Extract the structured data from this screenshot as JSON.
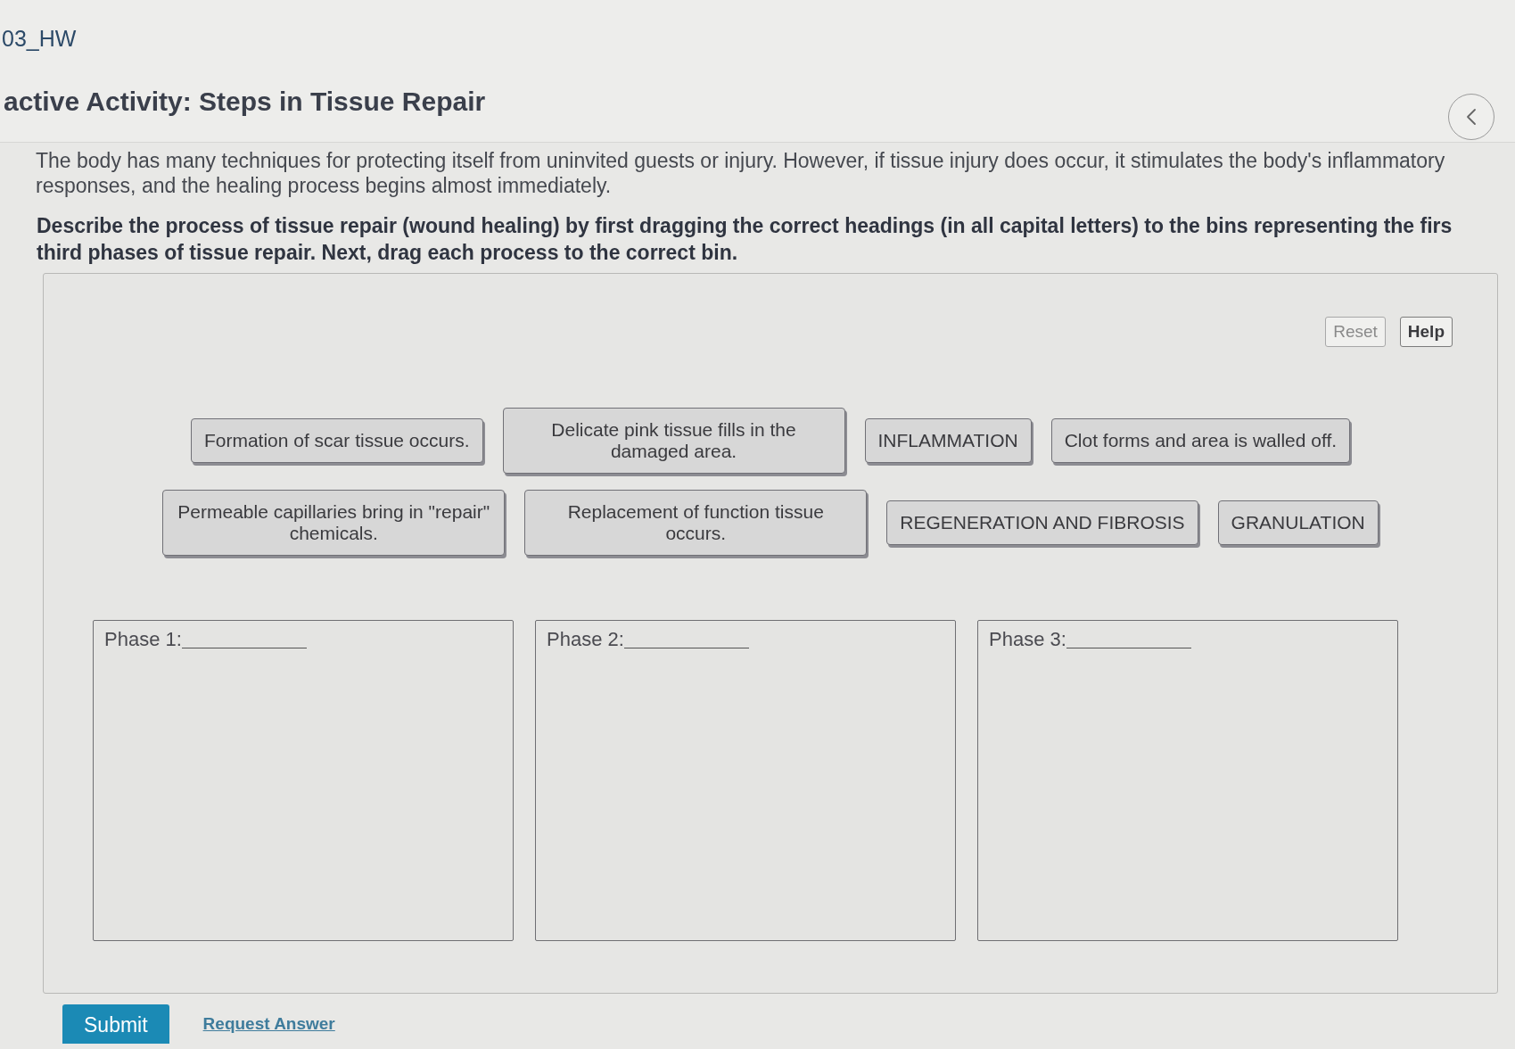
{
  "assignment": {
    "title": "03_HW"
  },
  "activity": {
    "title": "active Activity: Steps in Tissue Repair"
  },
  "intro": {
    "lines": [
      "The body has many techniques for protecting itself from uninvited guests or injury. However, if tissue injury does occur, it stimulates the body's inflammatory",
      "responses, and the healing process begins almost immediately."
    ]
  },
  "instructions": {
    "lines": [
      "Describe the process of tissue repair (wound healing) by first dragging the correct headings (in all capital letters) to the bins representing the firs",
      "third phases of tissue repair. Next, drag each process to the correct bin."
    ]
  },
  "toolbar": {
    "buttons": [
      {
        "label": "Reset",
        "disabled": true
      },
      {
        "label": "Help",
        "disabled": false
      }
    ]
  },
  "tile_rows": [
    [
      {
        "label": "Formation of scar tissue occurs."
      },
      {
        "label": "Delicate pink tissue fills in the damaged area."
      },
      {
        "label": "INFLAMMATION"
      },
      {
        "label": "Clot forms and area is walled off."
      }
    ],
    [
      {
        "label": "Permeable capillaries bring in \"repair\" chemicals."
      },
      {
        "label": "Replacement of function tissue occurs."
      },
      {
        "label": "REGENERATION AND FIBROSIS"
      },
      {
        "label": "GRANULATION"
      }
    ]
  ],
  "bins": [
    {
      "label": "Phase 1:"
    },
    {
      "label": "Phase 2:"
    },
    {
      "label": "Phase 3:"
    }
  ],
  "footer": {
    "submit": "Submit",
    "request_answer": "Request Answer"
  }
}
